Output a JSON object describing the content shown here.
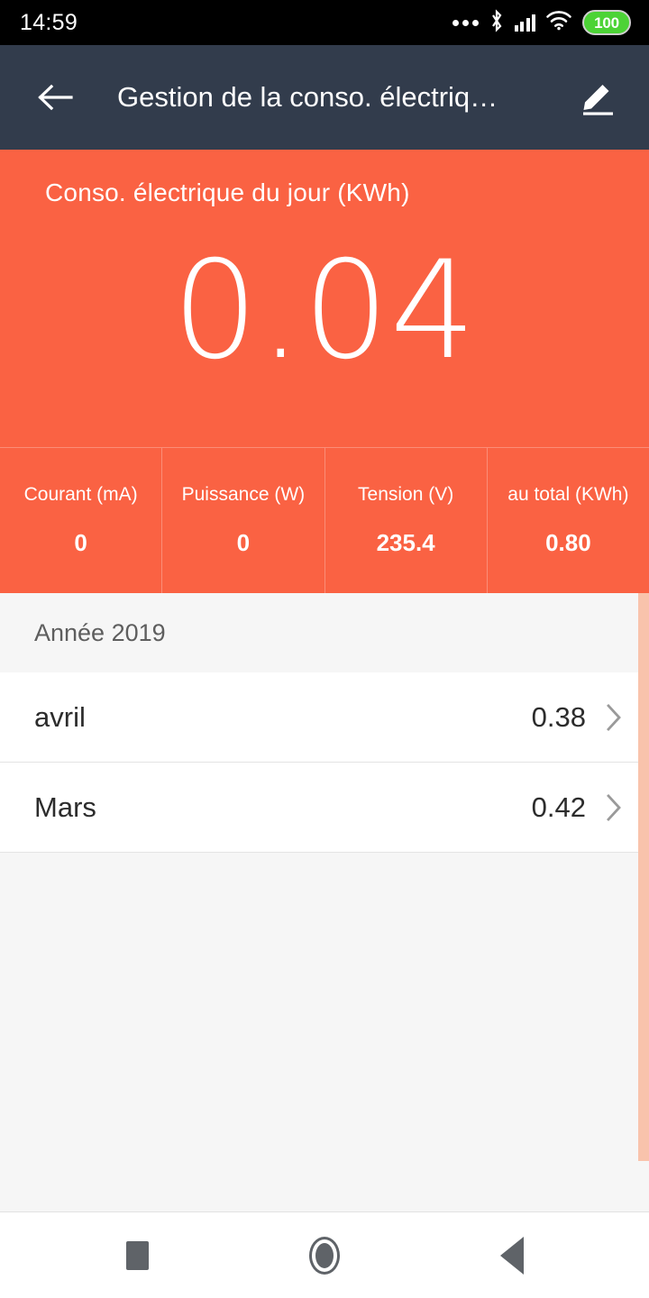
{
  "status_bar": {
    "clock": "14:59",
    "icons": [
      "more-dots-icon",
      "bluetooth-icon",
      "signal-icon",
      "wifi-icon",
      "battery-icon"
    ],
    "battery_level": "100"
  },
  "app_bar": {
    "back_icon": "arrow-left-icon",
    "title": "Gestion de la conso. électriq…",
    "edit_icon": "pencil-edit-icon",
    "background_color": "#323C4C"
  },
  "hero": {
    "label": "Conso. électrique du jour (KWh)",
    "value": "0.04",
    "background_color": "#FA6243"
  },
  "stats": [
    {
      "label": "Courant (mA)",
      "value": "0"
    },
    {
      "label": "Puissance (W)",
      "value": "0"
    },
    {
      "label": "Tension (V)",
      "value": "235.4"
    },
    {
      "label": "au total (KWh)",
      "value": "0.80"
    }
  ],
  "list": {
    "section_header": "Année 2019",
    "rows": [
      {
        "name": "avril",
        "value": "0.38",
        "chevron": "chevron-right-icon"
      },
      {
        "name": "Mars",
        "value": "0.42",
        "chevron": "chevron-right-icon"
      }
    ],
    "scrollbar_color": "#F9C3AC"
  },
  "nav_bar": {
    "recents": "recents-square-icon",
    "home": "home-circle-icon",
    "back": "back-triangle-icon"
  }
}
